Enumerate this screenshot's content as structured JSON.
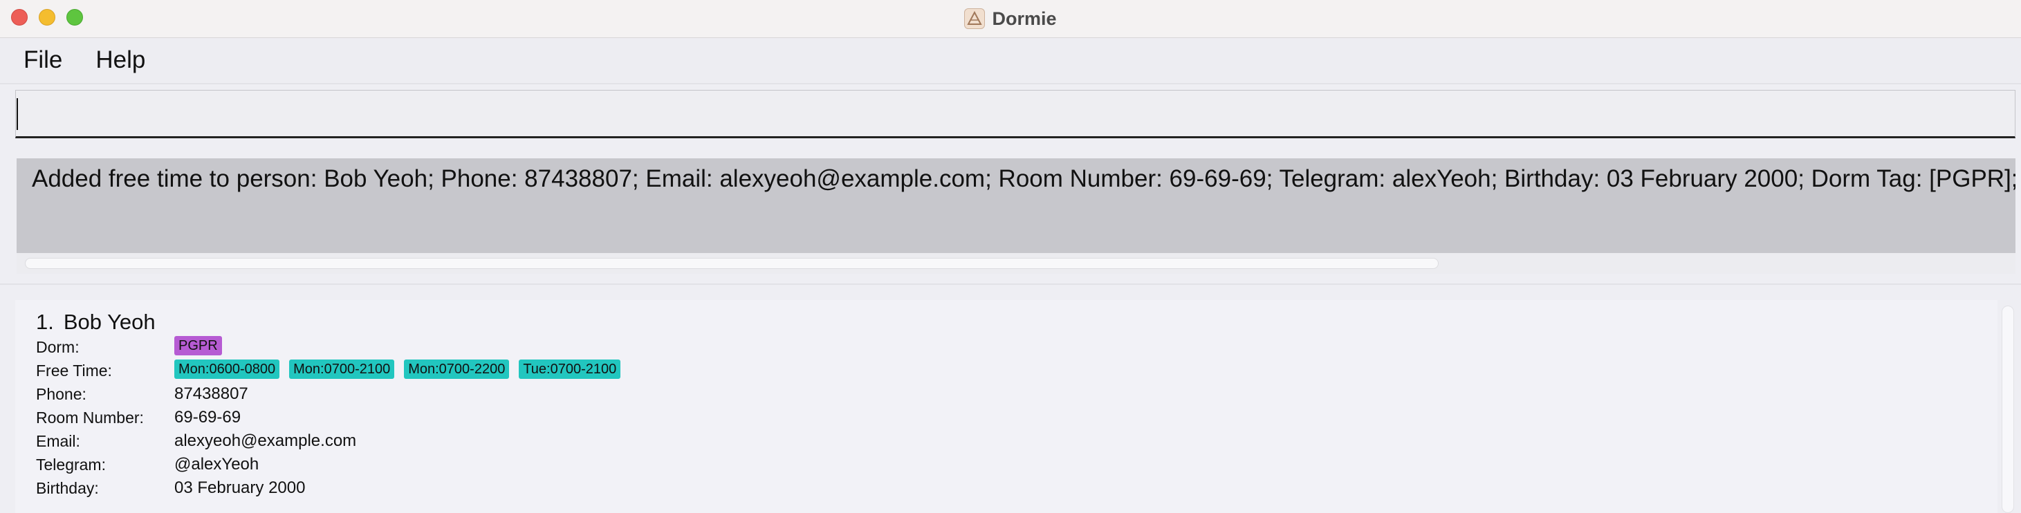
{
  "window": {
    "title": "Dormie"
  },
  "menu": {
    "file": "File",
    "help": "Help"
  },
  "command": {
    "value": "",
    "placeholder": ""
  },
  "result": {
    "text": "Added free time to person: Bob Yeoh; Phone: 87438807; Email: alexyeoh@example.com; Room Number: 69-69-69; Telegram: alexYeoh; Birthday: 03 February 2000; Dorm Tag: [PGPR]; Free Time Ta"
  },
  "persons": [
    {
      "index": "1.",
      "name": "Bob Yeoh",
      "labels": {
        "dorm": "Dorm:",
        "free_time": "Free Time:",
        "phone": "Phone:",
        "room": "Room Number:",
        "email": "Email:",
        "telegram": "Telegram:",
        "birthday": "Birthday:"
      },
      "dorm_tag": "PGPR",
      "free_times": [
        "Mon:0600-0800",
        "Mon:0700-2100",
        "Mon:0700-2200",
        "Tue:0700-2100"
      ],
      "phone": "87438807",
      "room": "69-69-69",
      "email": "alexyeoh@example.com",
      "telegram": "@alexYeoh",
      "birthday": "03 February 2000"
    }
  ],
  "colors": {
    "dorm_tag": "#b65bd3",
    "free_time_tag": "#22c6bf",
    "result_bg": "#c7c7cc",
    "close": "#ed5e57",
    "minimize": "#f4bd2f",
    "maximize": "#5ec53f"
  },
  "icons": {
    "app": "dormie-app-icon",
    "close": "close-window-icon",
    "minimize": "minimize-window-icon",
    "maximize": "maximize-window-icon"
  }
}
